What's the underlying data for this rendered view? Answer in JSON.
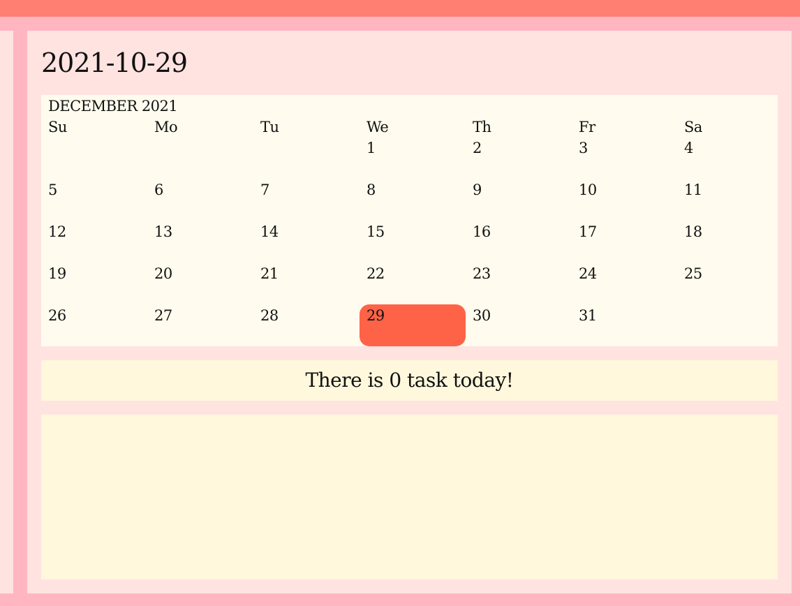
{
  "page": {
    "title": "2021-10-29"
  },
  "calendar": {
    "month_label": "DECEMBER 2021",
    "weekdays": [
      "Su",
      "Mo",
      "Tu",
      "We",
      "Th",
      "Fr",
      "Sa"
    ],
    "weeks": [
      [
        "",
        "",
        "",
        "1",
        "2",
        "3",
        "4"
      ],
      [
        "5",
        "6",
        "7",
        "8",
        "9",
        "10",
        "11"
      ],
      [
        "12",
        "13",
        "14",
        "15",
        "16",
        "17",
        "18"
      ],
      [
        "19",
        "20",
        "21",
        "22",
        "23",
        "24",
        "25"
      ],
      [
        "26",
        "27",
        "28",
        "29",
        "30",
        "31",
        ""
      ]
    ],
    "selected_day": "29"
  },
  "tasks": {
    "summary": "There is 0 task today!"
  },
  "colors": {
    "background": "#ffb6c1",
    "topbar": "#ff7f73",
    "panel": "#ffe3e1",
    "calendar_bg": "#fffbee",
    "task_bg": "#fff8dc",
    "selected_day": "#ff6347"
  }
}
